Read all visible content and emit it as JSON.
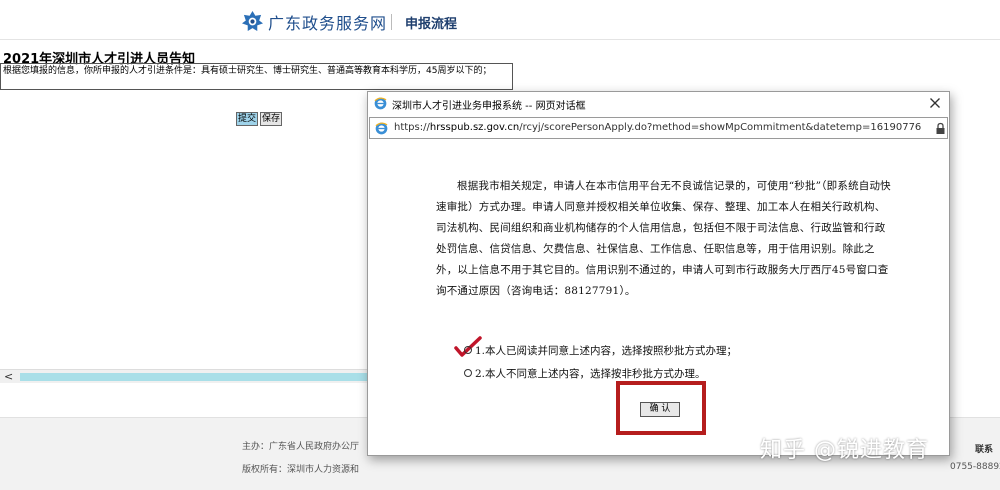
{
  "header": {
    "site_name": "广东政务服务网",
    "nav_link": "申报流程"
  },
  "page": {
    "notice_title": "2021年深圳市人才引进人员告知",
    "notice_text": "根据您填报的信息，你所申报的人才引进条件是：具有硕士研究生、博士研究生、普通高等教育本科学历，45周岁以下的；",
    "submit_label": "提交",
    "save_label": "保存",
    "scroll_left_arrow": "<"
  },
  "footer": {
    "sponsor": "主办：广东省人民政府办公厅",
    "copyright": "版权所有：深圳市人力资源和",
    "contact": "联系",
    "phone": "0755-88892"
  },
  "dialog": {
    "title": "深圳市人才引进业务申报系统 -- 网页对话框",
    "url_prefix": "https://",
    "url_host": "hrsspub.sz.gov.cn",
    "url_path": "/rcyj/scorePersonApply.do?method=showMpCommitment&datetemp=16190776",
    "body_text": "根据我市相关规定，申请人在本市信用平台无不良诚信记录的，可使用“秒批”（即系统自动快速审批）方式办理。申请人同意并授权相关单位收集、保存、整理、加工本人在相关行政机构、司法机构、民间组织和商业机构储存的个人信用信息，包括但不限于司法信息、行政监管和行政处罚信息、信贷信息、欠费信息、社保信息、工作信息、任职信息等，用于信用识别。除此之外，以上信息不用于其它目的。信用识别不通过的，申请人可到市行政服务大厅西厅45号窗口查询不通过原因（咨询电话：88127791）。",
    "option_1": "1.本人已阅读并同意上述内容，选择按照秒批方式办理；",
    "option_2": "2.本人不同意上述内容，选择按非秒批方式办理。",
    "confirm_label": "确 认"
  },
  "watermark": "知乎 @锐进教育",
  "colors": {
    "brand_blue": "#1f4e8c",
    "highlight_red": "#b51d1d",
    "checkmark_red": "#c0152a",
    "scroll_thumb": "#a9dfe8"
  }
}
